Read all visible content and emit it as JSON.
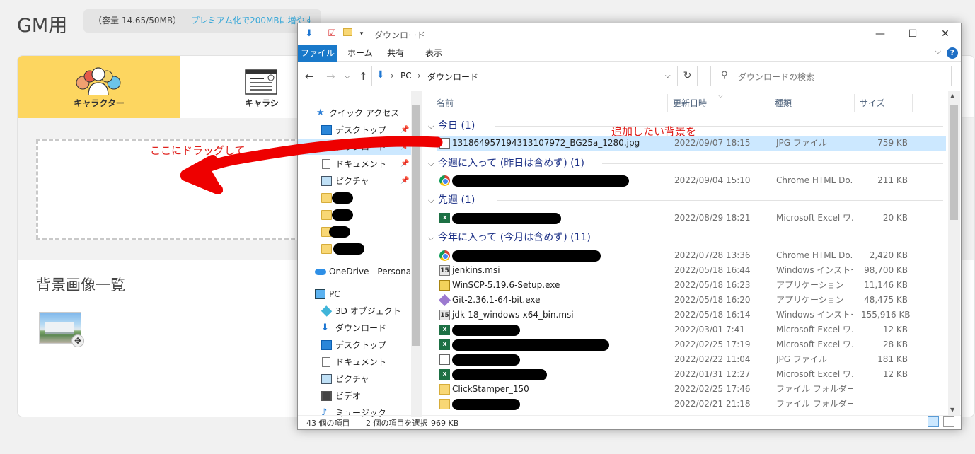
{
  "app": {
    "title": "GM用",
    "capacity_text": "（容量 14.65/50MB）",
    "capacity_link": "プレミアム化で200MBに増やす",
    "tabs": [
      {
        "label": "キャラクター",
        "active": true
      },
      {
        "label": "キャラシ",
        "active": false
      }
    ],
    "drop_hint": "ここにドラッグして",
    "bg_list_title": "背景画像一覧",
    "accent_color": "#fdd660"
  },
  "annotation": {
    "text": "追加したい背景を",
    "color": "#e0201c"
  },
  "explorer": {
    "window_title": "ダウンロード",
    "ribbon_tabs": [
      "ファイル",
      "ホーム",
      "共有",
      "表示"
    ],
    "address": [
      "PC",
      "ダウンロード"
    ],
    "search_placeholder": "ダウンロードの検索",
    "nav": [
      {
        "label": "クイック アクセス",
        "icon": "star-icon"
      },
      {
        "label": "デスクトップ",
        "icon": "desktop-icon",
        "pinned": true
      },
      {
        "label": "ダウンロード",
        "icon": "download-icon",
        "pinned": true
      },
      {
        "label": "ドキュメント",
        "icon": "document-icon",
        "pinned": true
      },
      {
        "label": "ピクチャ",
        "icon": "picture-icon",
        "pinned": true
      },
      {
        "label": "",
        "icon": "folder-icon"
      },
      {
        "label": "",
        "icon": "folder-icon"
      },
      {
        "label": "",
        "icon": "folder-icon"
      },
      {
        "label": "",
        "icon": "folder-icon"
      },
      {
        "label": "OneDrive - Personal",
        "icon": "onedrive-icon"
      },
      {
        "label": "PC",
        "icon": "pc-icon"
      },
      {
        "label": "3D オブジェクト",
        "icon": "3d-objects-icon"
      },
      {
        "label": "ダウンロード",
        "icon": "download-icon"
      },
      {
        "label": "デスクトップ",
        "icon": "desktop-icon"
      },
      {
        "label": "ドキュメント",
        "icon": "document-icon"
      },
      {
        "label": "ピクチャ",
        "icon": "picture-icon"
      },
      {
        "label": "ビデオ",
        "icon": "video-icon"
      },
      {
        "label": "ミュージック",
        "icon": "music-icon"
      }
    ],
    "columns": {
      "name": "名前",
      "date": "更新日時",
      "type": "種類",
      "size": "サイズ"
    },
    "groups": [
      {
        "label": "今日 (1)",
        "files": [
          {
            "name": "131864957194313107972_BG25a_1280.jpg",
            "date": "2022/09/07 18:15",
            "type": "JPG ファイル",
            "size": "759 KB",
            "icon": "jpg-file-icon",
            "selected": true
          }
        ]
      },
      {
        "label": "今週に入って (昨日は含めず) (1)",
        "files": [
          {
            "name": "",
            "date": "2022/09/04 15:10",
            "type": "Chrome HTML Do...",
            "size": "211 KB",
            "icon": "chrome-icon",
            "redacted": true
          }
        ]
      },
      {
        "label": "先週 (1)",
        "files": [
          {
            "name": "",
            "date": "2022/08/29 18:21",
            "type": "Microsoft Excel ワ...",
            "size": "20 KB",
            "icon": "excel-icon",
            "redacted": true
          }
        ]
      },
      {
        "label": "今年に入って (今月は含めず) (11)",
        "files": [
          {
            "name": "",
            "date": "2022/07/28 13:36",
            "type": "Chrome HTML Do...",
            "size": "2,420 KB",
            "icon": "chrome-icon",
            "redacted": true
          },
          {
            "name": "jenkins.msi",
            "date": "2022/05/18 16:44",
            "type": "Windows インストー...",
            "size": "98,700 KB",
            "icon": "msi-icon"
          },
          {
            "name": "WinSCP-5.19.6-Setup.exe",
            "date": "2022/05/18 16:23",
            "type": "アプリケーション",
            "size": "11,146 KB",
            "icon": "exe-icon"
          },
          {
            "name": "Git-2.36.1-64-bit.exe",
            "date": "2022/05/18 16:20",
            "type": "アプリケーション",
            "size": "48,475 KB",
            "icon": "git-icon"
          },
          {
            "name": "jdk-18_windows-x64_bin.msi",
            "date": "2022/05/18 16:14",
            "type": "Windows インストー...",
            "size": "155,916 KB",
            "icon": "msi-icon"
          },
          {
            "name": "",
            "date": "2022/03/01 7:41",
            "type": "Microsoft Excel ワ...",
            "size": "12 KB",
            "icon": "excel-icon",
            "redacted": true
          },
          {
            "name": "",
            "date": "2022/02/25 17:19",
            "type": "Microsoft Excel ワ...",
            "size": "28 KB",
            "icon": "excel-icon",
            "redacted": true
          },
          {
            "name": "",
            "date": "2022/02/22 11:04",
            "type": "JPG ファイル",
            "size": "181 KB",
            "icon": "jpg-file-icon",
            "redacted": true
          },
          {
            "name": "",
            "date": "2022/01/31 12:27",
            "type": "Microsoft Excel ワ...",
            "size": "12 KB",
            "icon": "excel-icon",
            "redacted": true
          },
          {
            "name": "ClickStamper_150",
            "date": "2022/02/25 17:46",
            "type": "ファイル フォルダー",
            "size": "",
            "icon": "folder-icon"
          },
          {
            "name": "",
            "date": "2022/02/21 21:18",
            "type": "ファイル フォルダー",
            "size": "",
            "icon": "folder-icon",
            "redacted": true
          }
        ]
      }
    ],
    "status": {
      "item_count": "43 個の項目",
      "selection": "2 個の項目を選択",
      "selection_size": "969 KB"
    }
  }
}
